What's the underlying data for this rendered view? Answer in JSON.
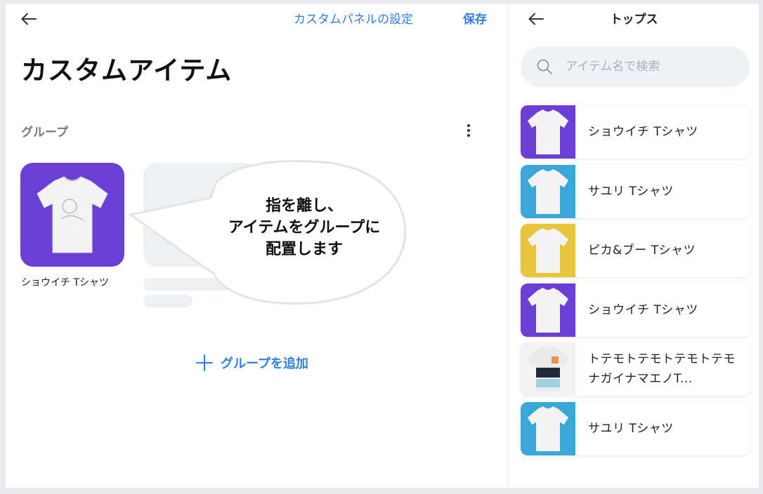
{
  "left_panel": {
    "settings_link": "カスタムパネルの設定",
    "save_label": "保存",
    "title": "カスタムアイテム",
    "group_label": "グループ",
    "tile": {
      "caption": "ショウイチ Tシャツ",
      "bg_color": "#6b3fd6"
    },
    "bubble_lines": [
      "指を離し、",
      "アイテムをグループに",
      "配置します"
    ],
    "add_group_label": "グループを追加"
  },
  "right_panel": {
    "title": "トップス",
    "search_placeholder": "アイテム名で検索",
    "items": [
      {
        "label": "ショウイチ Tシャツ",
        "thumb_color": "#6b3fd6"
      },
      {
        "label": "サユリ Tシャツ",
        "thumb_color": "#3aa7d8"
      },
      {
        "label": "ピカ&ブー Tシャツ",
        "thumb_color": "#e8c43a"
      },
      {
        "label": "ショウイチ Tシャツ",
        "thumb_color": "#6b3fd6"
      },
      {
        "label": "トテモトテモトテモトテモナガイナマエノT...",
        "thumb_color": "#f2f2f2"
      },
      {
        "label": "サユリ Tシャツ",
        "thumb_color": "#3aa7d8"
      }
    ]
  },
  "colors": {
    "accent": "#2f7fe0"
  }
}
